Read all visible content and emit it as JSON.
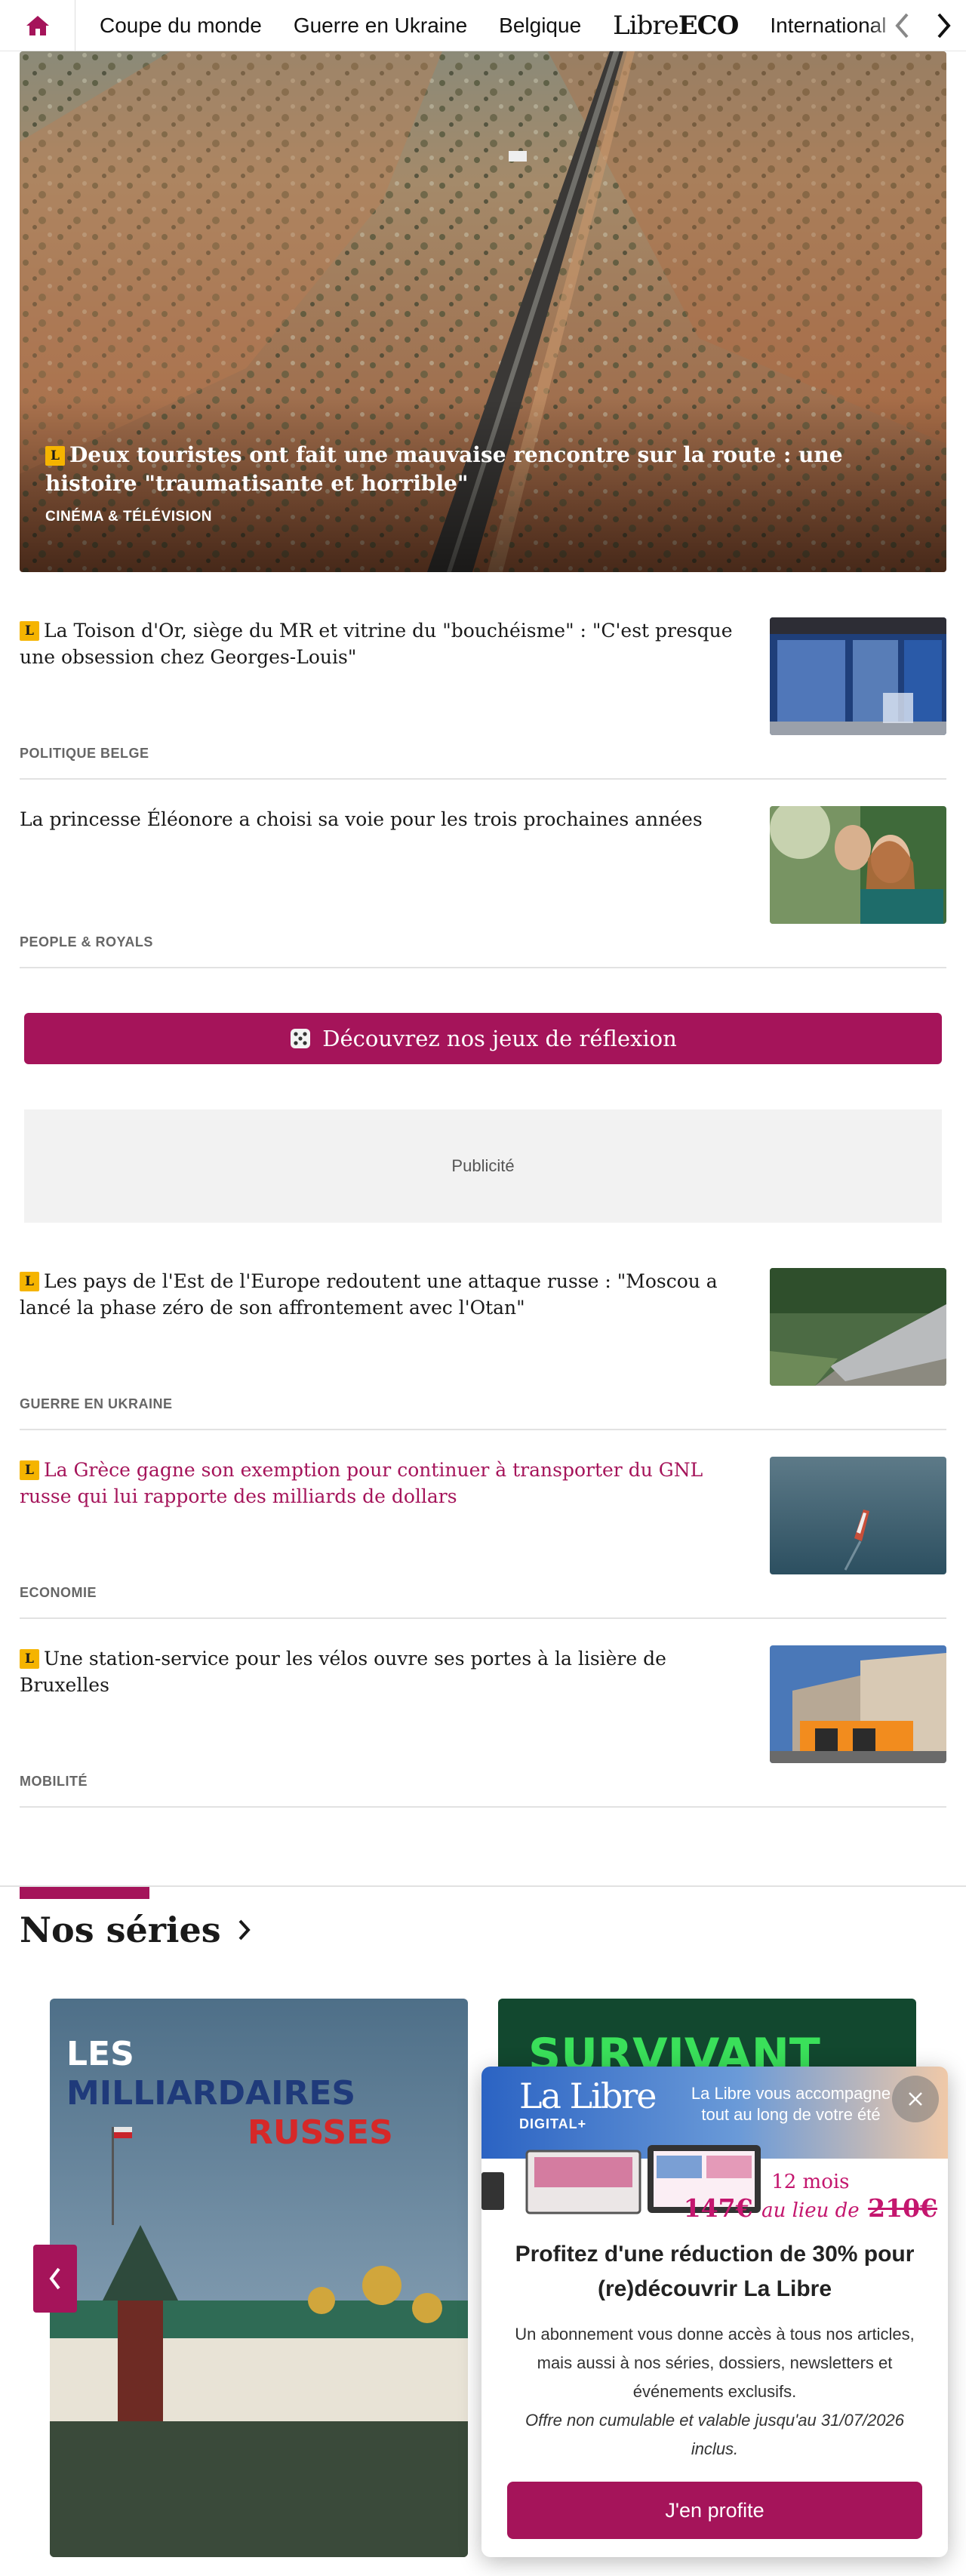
{
  "nav": {
    "items": [
      "Coupe du monde",
      "Guerre en Ukraine",
      "Belgique"
    ],
    "logo_light": "Libre",
    "logo_bold": "ECO",
    "item_last": "International"
  },
  "hero": {
    "badge": "L",
    "title": "Deux touristes ont fait une mauvaise rencontre sur la route : une histoire \"traumatisante et horrible\"",
    "category": "CINÉMA & TÉLÉVISION"
  },
  "articles": [
    {
      "badge": "L",
      "title": "La Toison d'Or, siège du MR et vitrine du \"bouchéisme\" : \"C'est presque une obsession chez Georges-Louis\"",
      "category": "POLITIQUE BELGE"
    },
    {
      "title": "La princesse Éléonore a choisi sa voie pour les trois prochaines années",
      "category": "PEOPLE & ROYALS"
    },
    {
      "badge": "L",
      "title": "Les pays de l'Est de l'Europe redoutent une attaque russe : \"Moscou a lancé la phase zéro de son affrontement avec l'Otan\"",
      "category": "GUERRE EN UKRAINE"
    },
    {
      "badge": "L",
      "title": "La Grèce gagne son exemption pour continuer à transporter du GNL russe qui lui rapporte des milliards de dollars",
      "category": "ECONOMIE"
    },
    {
      "badge": "L",
      "title": "Une station-service pour les vélos ouvre ses portes à la lisière de Bruxelles",
      "category": "MOBILITÉ"
    }
  ],
  "cta": {
    "label": "Découvrez nos jeux de réflexion"
  },
  "ad": {
    "label": "Publicité"
  },
  "series": {
    "title": "Nos séries",
    "card1": {
      "line1": "LES",
      "line2": "MILLIARDAIRES",
      "line3": "RUSSES"
    },
    "card2": {
      "text": "SURVIVANT"
    }
  },
  "popup": {
    "logo": "La Libre",
    "logo_sub": "DIGITAL+",
    "tagline": "La Libre vous accompagne tout au long de votre été",
    "months": "12 mois",
    "price": "147€",
    "instead": "au lieu de",
    "old_price": "210€",
    "heading": "Profitez d'une réduction de 30% pour (re)découvrir La Libre",
    "body": "Un abonnement vous donne accès à tous nos articles, mais aussi à nos séries, dossiers, newsletters et événements exclusifs.",
    "note": "Offre non cumulable et valable jusqu'au 31/07/2026 inclus.",
    "button": "J'en profite"
  },
  "colors": {
    "brand": "#a5145a",
    "badge": "#f5b400"
  }
}
